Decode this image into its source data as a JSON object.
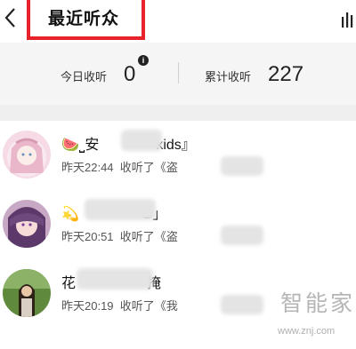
{
  "header": {
    "title": "最近听众",
    "back_icon": "chevron-left-icon",
    "chart_icon": "bar-chart-icon"
  },
  "stats": {
    "today_label": "今日收听",
    "today_value": "0",
    "info_icon": "info-icon",
    "total_label": "累计收听",
    "total_value": "227"
  },
  "listeners": [
    {
      "emoji": "🍉",
      "name_start": "⎵安",
      "name_end": "kids』",
      "time": "昨天22:44",
      "action": "收听了",
      "program_prefix": "《盗"
    },
    {
      "emoji": "💫",
      "name_start": "",
      "name_end": "G」",
      "time": "昨天20:51",
      "action": "收听了",
      "program_prefix": "《盗"
    },
    {
      "emoji": "",
      "name_start": "花",
      "name_end": "掩",
      "time": "昨天20:19",
      "action": "收听了",
      "program_prefix": "《我"
    }
  ],
  "watermark": {
    "text": "智能家",
    "url": "www.znj.com"
  },
  "colors": {
    "highlight_box": "#e8222a",
    "stats_bg": "#f5f5f5"
  }
}
